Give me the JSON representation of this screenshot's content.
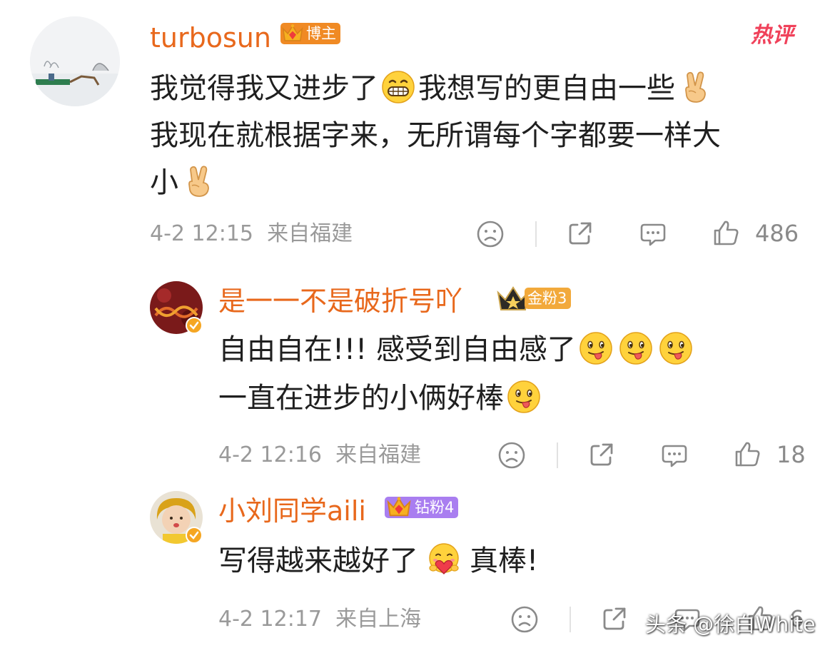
{
  "comments": [
    {
      "username": "turbosun",
      "badge": "博主",
      "hot_label": "热评",
      "text_parts": [
        "我觉得我又进步了",
        "我想写的更自由一些",
        "我现在就根据字来，无所谓每个字都要一样大",
        "小"
      ],
      "emojis": [
        "grin-emoji",
        "victory-hand-emoji",
        "victory-hand-emoji"
      ],
      "date": "4-2 12:15",
      "location": "来自福建",
      "likes": "486"
    },
    {
      "username": "是一一不是破折号吖",
      "badge": "金粉3",
      "text_parts": [
        "自由自在!!! 感受到自由感了",
        "一直在进步的小俩好棒"
      ],
      "emojis": [
        "tongue-emoji",
        "tongue-emoji",
        "tongue-emoji",
        "tongue-emoji"
      ],
      "date": "4-2 12:16",
      "location": "来自福建",
      "likes": "18"
    },
    {
      "username": "小刘同学aili",
      "badge": "钻粉4",
      "text_parts": [
        "写得越来越好了",
        "真棒!"
      ],
      "emojis": [
        "hug-emoji"
      ],
      "date": "4-2 12:17",
      "location": "来自上海",
      "likes": "6"
    }
  ],
  "watermark": "头条 @徐白White",
  "colors": {
    "username": "#e8681c",
    "badge_blogger": "#f08a24",
    "badge_gold": "#f2a93b",
    "badge_diamond": "#a97ef0",
    "hot": "#f0415a"
  }
}
